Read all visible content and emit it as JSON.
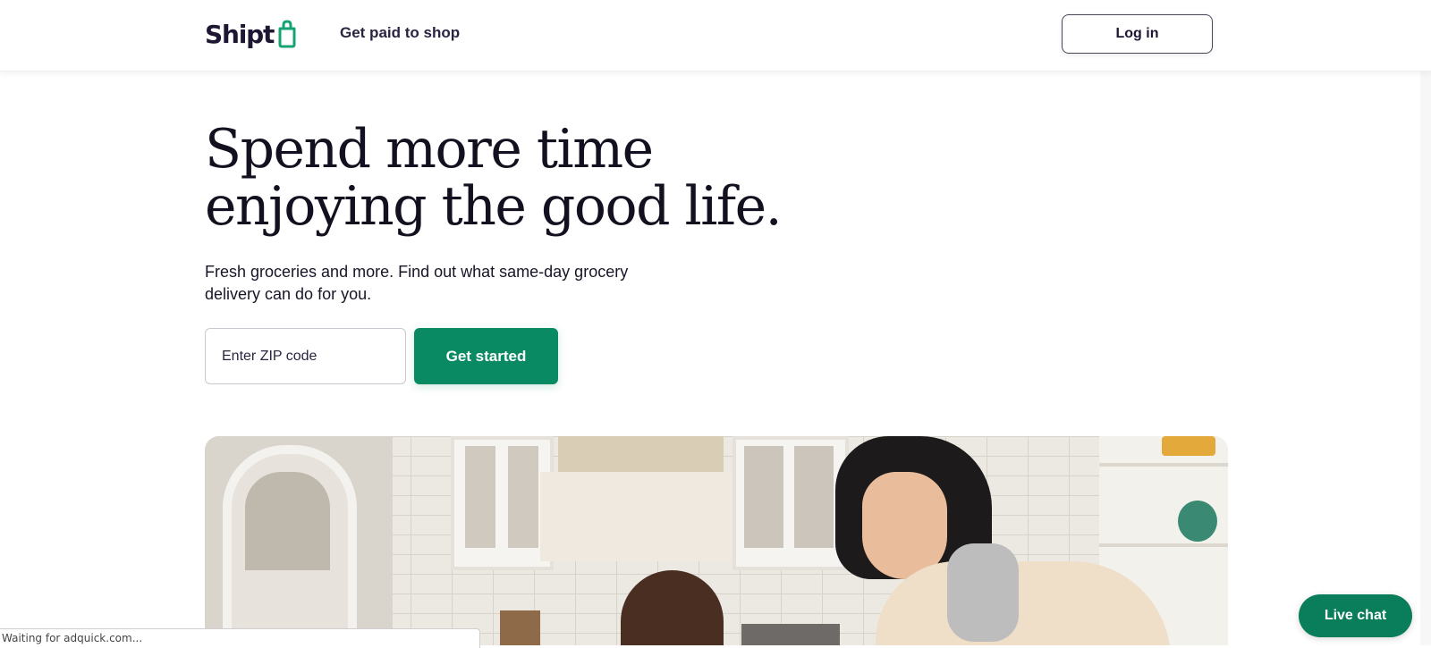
{
  "header": {
    "logo_text": "Shipt",
    "nav_link": "Get paid to shop",
    "login_label": "Log in"
  },
  "hero": {
    "title_line1": "Spend more time",
    "title_line2": "enjoying the good life.",
    "subtitle": "Fresh groceries and more. Find out what same-day grocery delivery can do for you.",
    "zip_placeholder": "Enter ZIP code",
    "cta_label": "Get started"
  },
  "status_bar": {
    "text": "Waiting for adquick.com..."
  },
  "live_chat": {
    "label": "Live chat"
  },
  "colors": {
    "brand_green": "#0a8a63",
    "live_chat_green": "#0a7d5a",
    "logo_ink": "#1f1633"
  }
}
